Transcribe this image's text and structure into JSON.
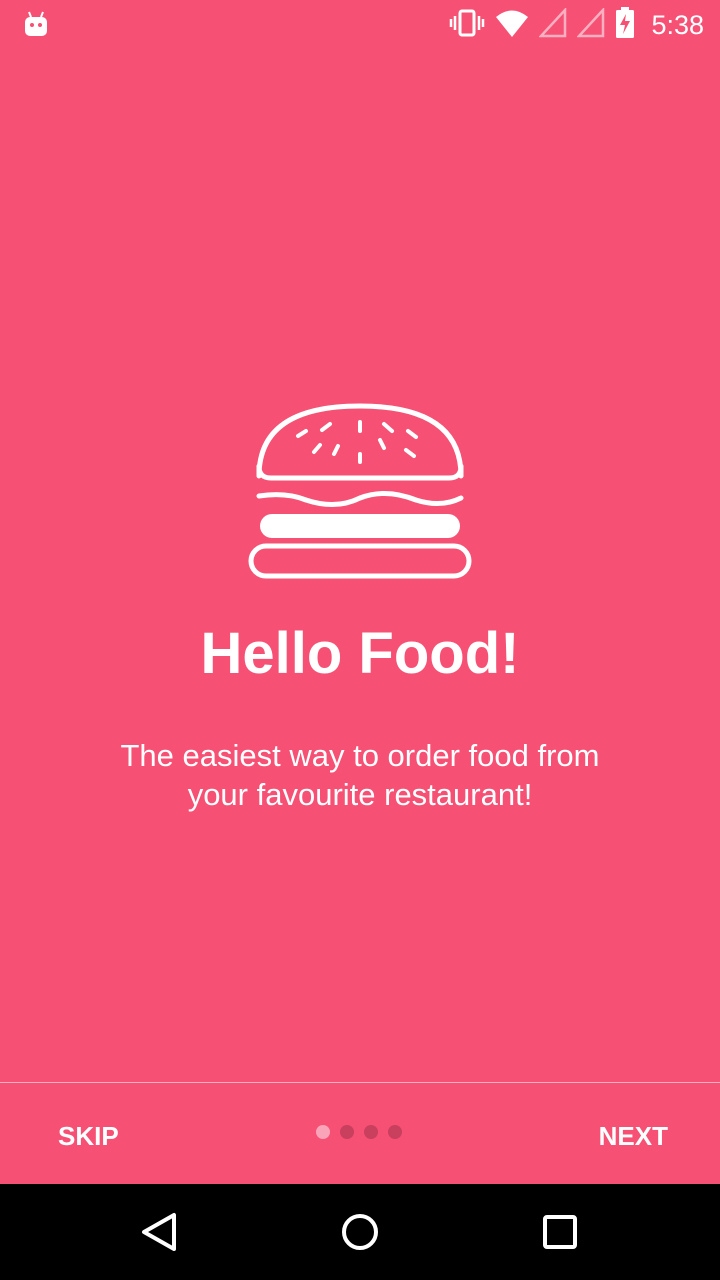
{
  "status_bar": {
    "time": "5:38",
    "icons": [
      "android-debug-icon",
      "vibrate-icon",
      "wifi-icon",
      "signal-icon",
      "signal-icon",
      "battery-charging-icon"
    ]
  },
  "onboarding": {
    "illustration": "burger-icon",
    "title": "Hello Food!",
    "description": "The easiest way to order food from your favourite restaurant!",
    "page_indicator": {
      "count": 4,
      "active_index": 0
    }
  },
  "footer": {
    "skip_label": "SKIP",
    "next_label": "NEXT"
  },
  "nav_bar": {
    "icons": [
      "back-icon",
      "home-icon",
      "recents-icon"
    ]
  },
  "colors": {
    "background": "#F75075",
    "dot_active": "#F9A4B8",
    "dot_inactive": "#C93F5E",
    "nav_bar": "#000000"
  }
}
